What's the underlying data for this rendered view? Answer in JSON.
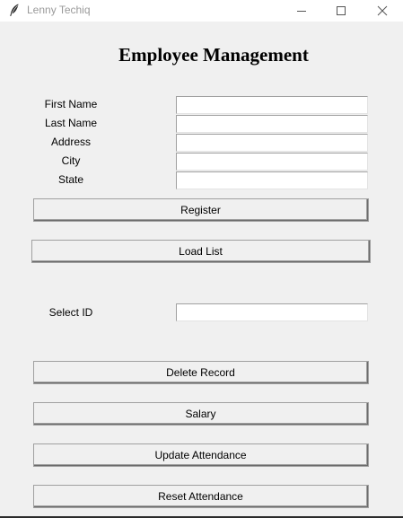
{
  "window": {
    "title": "Lenny Techiq",
    "app_icon": "feather-icon",
    "controls": [
      "minimize-icon",
      "maximize-icon",
      "close-icon"
    ]
  },
  "heading": "Employee Management",
  "form": {
    "first_name_label": "First Name",
    "last_name_label": "Last Name",
    "address_label": "Address",
    "city_label": "City",
    "state_label": "State",
    "first_name_value": "",
    "last_name_value": "",
    "address_value": "",
    "city_value": "",
    "state_value": ""
  },
  "buttons": {
    "register": "Register",
    "load_list": "Load List",
    "delete_record": "Delete Record",
    "salary": "Salary",
    "update_attendance": "Update Attendance",
    "reset_attendance": "Reset Attendance"
  },
  "select": {
    "label": "Select ID",
    "value": ""
  }
}
